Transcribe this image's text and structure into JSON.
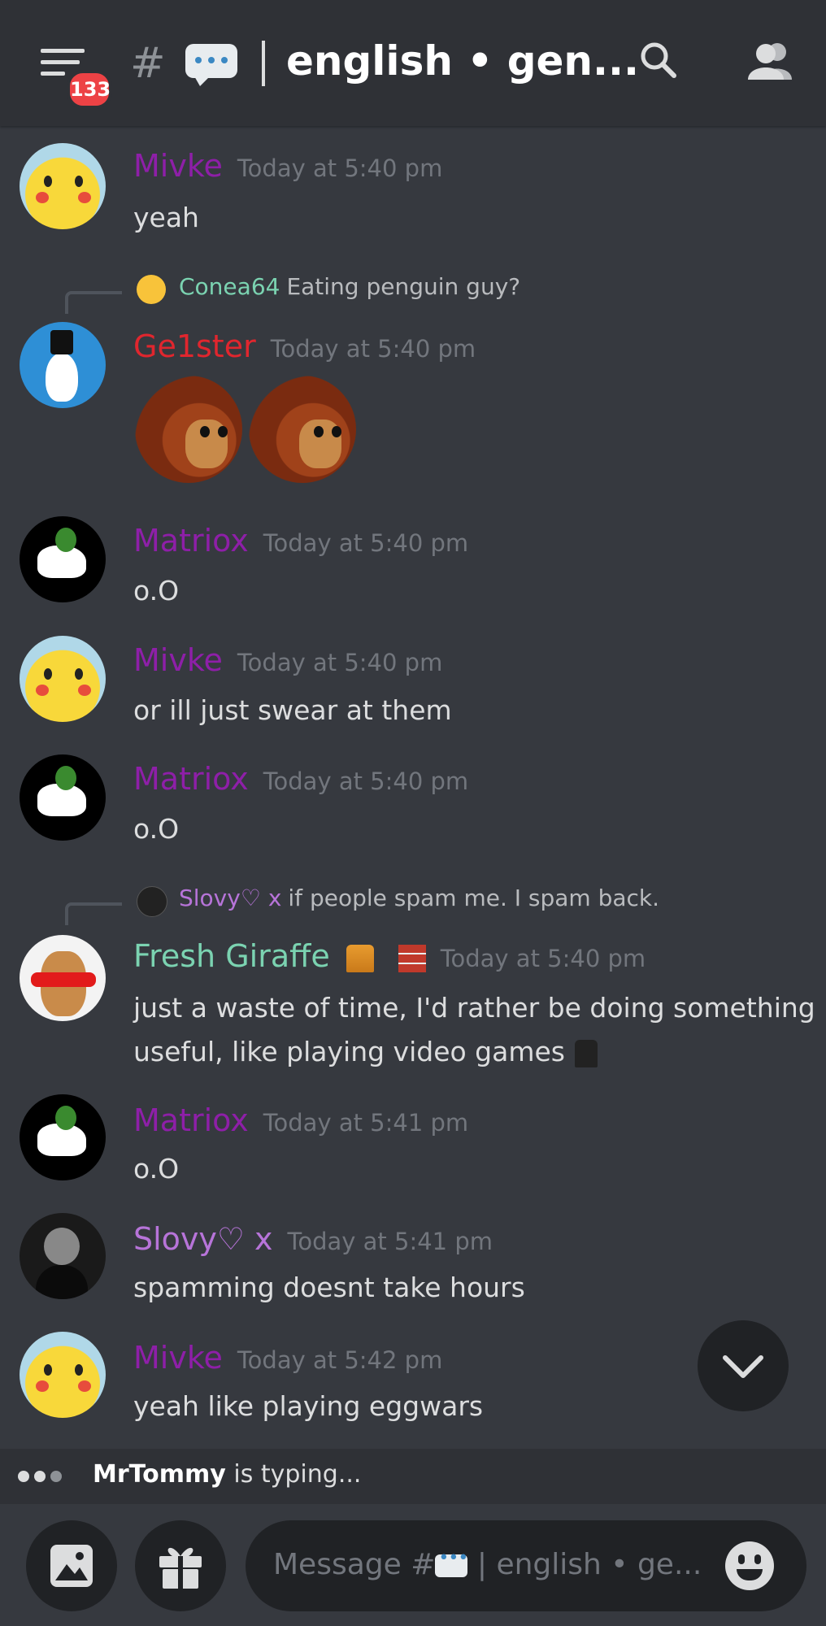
{
  "header": {
    "badge_count": "133",
    "hash": "#",
    "channel_title": "english • gen..."
  },
  "messages": [
    {
      "author": "Mivke",
      "time": "Today at 5:40 pm",
      "text": "yeah"
    },
    {
      "reply_author": "Conea64",
      "reply_text": "Eating penguin guy?",
      "author": "Ge1ster",
      "time": "Today at 5:40 pm",
      "text": ""
    },
    {
      "author": "Matriox",
      "time": "Today at 5:40 pm",
      "text": "o.O"
    },
    {
      "author": "Mivke",
      "time": "Today at 5:40 pm",
      "text": "or ill just swear at  them"
    },
    {
      "author": "Matriox",
      "time": "Today at 5:40 pm",
      "text": "o.O"
    },
    {
      "reply_author": "Slovy♡ x",
      "reply_text": "if people spam me. I spam back.",
      "author": "Fresh Giraffe",
      "time": "Today at 5:40 pm",
      "text": "just a waste of time, I'd rather be doing something",
      "text2": "useful, like playing video games"
    },
    {
      "author": "Matriox",
      "time": "Today at 5:41 pm",
      "text": "o.O"
    },
    {
      "author": "Slovy♡ x",
      "time": "Today at 5:41 pm",
      "text": "spamming doesnt take hours"
    },
    {
      "author": "Mivke",
      "time": "Today at 5:42 pm",
      "text": "yeah like playing eggwars"
    }
  ],
  "typing": {
    "user": "MrTommy",
    "suffix": "is typing..."
  },
  "composer": {
    "placeholder_prefix": "Message #",
    "placeholder_suffix": "english • ge..."
  },
  "colors": {
    "background": "#36393f",
    "header": "#2f3136",
    "purple": "#8e1fa8",
    "red": "#e0262e",
    "green": "#7bd3b1",
    "violet": "#b774d9"
  }
}
